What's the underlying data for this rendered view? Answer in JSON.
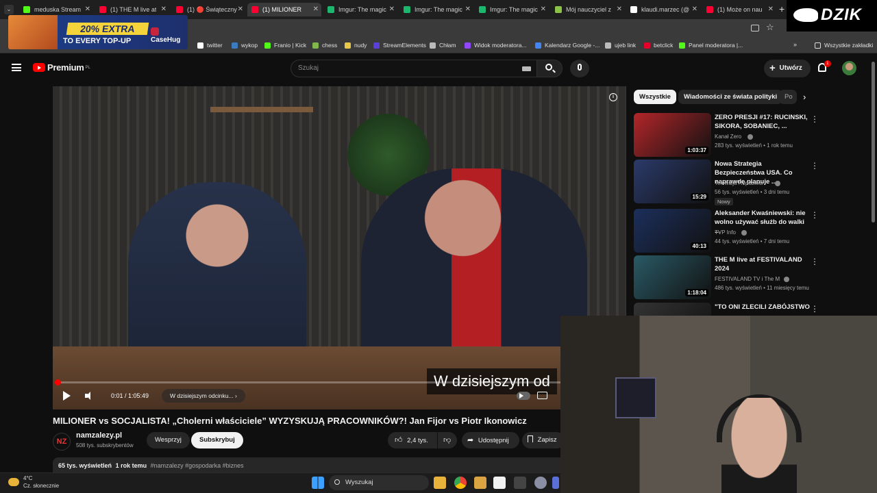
{
  "browser": {
    "tabs": [
      {
        "title": "meduska Stream",
        "color": "#53fc18"
      },
      {
        "title": "(1) THE M live at",
        "color": "#ff0033"
      },
      {
        "title": "(1) 🔴 Świąteczny",
        "color": "#ff0033"
      },
      {
        "title": "(1) MILIONER",
        "color": "#ff0033",
        "active": true
      },
      {
        "title": "Imgur: The magic",
        "color": "#1bb76e"
      },
      {
        "title": "Imgur: The magic",
        "color": "#1bb76e"
      },
      {
        "title": "Imgur: The magic",
        "color": "#1bb76e"
      },
      {
        "title": "Mój nauczyciel z",
        "color": "#8bc34a"
      },
      {
        "title": "klaudi.marzec (@",
        "color": "#ffffff"
      },
      {
        "title": "(1) Może on nau",
        "color": "#ff0033"
      }
    ],
    "bookmarks": [
      {
        "label": "twitter",
        "color": "#ffffff"
      },
      {
        "label": "wykop",
        "color": "#3b7bbf"
      },
      {
        "label": "Franio | Kick",
        "color": "#53fc18"
      },
      {
        "label": "chess",
        "color": "#81b64c"
      },
      {
        "label": "nudy",
        "color": "#e8c84a"
      },
      {
        "label": "StreamElements",
        "color": "#5b3fd8"
      },
      {
        "label": "Chłam",
        "color": "#bbbbbb"
      },
      {
        "label": "Widok moderatora...",
        "color": "#9146ff"
      },
      {
        "label": "Kalendarz Google -...",
        "color": "#4285f4"
      },
      {
        "label": "ujeb link",
        "color": "#bbbbbb"
      },
      {
        "label": "betclick",
        "color": "#e4002b"
      },
      {
        "label": "Panel moderatora |...",
        "color": "#53fc18"
      }
    ],
    "all_bookmarks": "Wszystkie zakładki"
  },
  "ad": {
    "line1": "20% EXTRA",
    "line2": "TO EVERY TOP-UP",
    "brand": "CaseHug"
  },
  "overlay": {
    "brand": "DZIK"
  },
  "youtube": {
    "logo": "Premium",
    "logo_sup": "PL",
    "search_placeholder": "Szukaj",
    "create_label": "Utwórz",
    "notif_count": "1"
  },
  "player": {
    "caption": "W dzisiejszym od",
    "time": "0:01 / 1:05:49",
    "chapter": "W dzisiejszym odcinku...",
    "progress": 0.0003
  },
  "video": {
    "title": "MILIONER vs SOCJALISTA! „Cholerni właściciele” WYZYSKUJĄ PRACOWNIKÓW?! Jan Fijor vs Piotr Ikonowicz",
    "channel": "namzalezy.pl",
    "channel_logo": "NZ",
    "subs": "508 tys. subskrybentów",
    "support_label": "Wesprzyj",
    "subscribe_label": "Subskrybuj",
    "likes": "2,4 tys.",
    "share_label": "Udostępnij",
    "save_label": "Zapisz",
    "views": "65 tys. wyświetleń",
    "age": "1 rok temu",
    "tags": "#namzalezy #gospodarka #biznes"
  },
  "chips": [
    "Wszystkie",
    "Wiadomości ze świata polityki",
    "Po"
  ],
  "recommendations": [
    {
      "title": "ZERO PRESJI #17: RUCINSKI, SIKORA, SOBANIEC, ...",
      "channel": "Kanał Zero",
      "meta": "283 tys. wyświetleń • 1 rok temu",
      "duration": "1:03:37",
      "thumb": "#b3262a"
    },
    {
      "title": "Nowa Strategia Bezpieczeństwa USA. Co naprawdę planuje ...",
      "channel": "Telewizja Republika",
      "meta": "56 tys. wyświetleń • 3 dni temu",
      "duration": "15:29",
      "thumb": "#2b3a6a",
      "badge": "Nowy"
    },
    {
      "title": "Aleksander Kwaśniewski: nie wolno używać służb do walki ...",
      "channel": "TVP Info",
      "meta": "44 tys. wyświetleń • 7 dni temu",
      "duration": "40:13",
      "thumb": "#1c2f5c"
    },
    {
      "title": "THE M live at FESTIVALAND 2024",
      "channel": "FESTIVALAND TV i The M",
      "meta": "486 tys. wyświetleń • 11 miesięcy temu",
      "duration": "1:18:04",
      "thumb": "#2a5a66"
    },
    {
      "title": "\"TO ONI ZLECILI ZABÓJSTWO",
      "channel": "",
      "meta": "",
      "duration": "",
      "thumb": "#333333"
    }
  ],
  "taskbar": {
    "temp": "4°C",
    "weather": "Cz. słonecznie",
    "search": "Wyszukaj"
  }
}
